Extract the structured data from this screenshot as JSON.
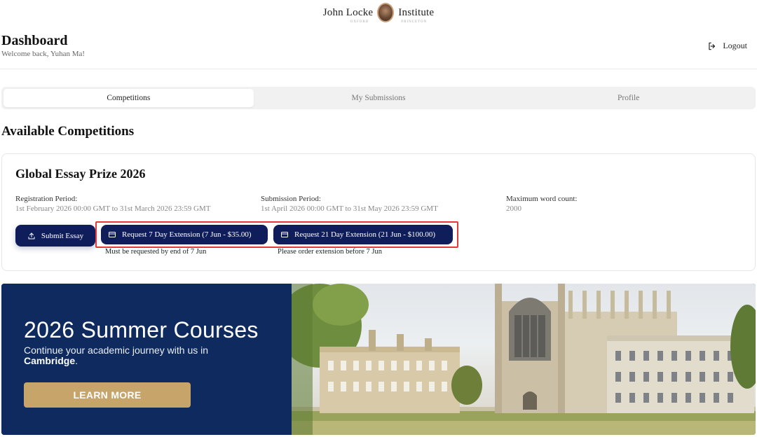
{
  "logo": {
    "left_word": "John Locke",
    "left_sub": "OXFORD",
    "right_word": "Institute",
    "right_sub": "PRINCETON"
  },
  "header": {
    "title": "Dashboard",
    "welcome": "Welcome back, Yuhan Ma!",
    "logout_label": "Logout"
  },
  "tabs": [
    {
      "label": "Competitions",
      "active": true
    },
    {
      "label": "My Submissions",
      "active": false
    },
    {
      "label": "Profile",
      "active": false
    }
  ],
  "section_title": "Available Competitions",
  "competition": {
    "title": "Global Essay Prize 2026",
    "registration": {
      "label": "Registration Period:",
      "value": "1st February 2026 00:00 GMT to 31st March 2026 23:59 GMT"
    },
    "submission": {
      "label": "Submission Period:",
      "value": "1st April 2026 00:00 GMT to 31st May 2026 23:59 GMT"
    },
    "word_count": {
      "label": "Maximum word count:",
      "value": "2000"
    },
    "buttons": {
      "submit": "Submit Essay",
      "ext7": "Request 7 Day Extension (7 Jun - $35.00)",
      "ext21": "Request 21 Day Extension (21 Jun - $100.00)"
    },
    "notes": {
      "ext7": "Must be requested by end of 7 Jun",
      "ext21": "Please order extension before 7 Jun"
    }
  },
  "banner": {
    "heading": "2026 Summer Courses",
    "text_prefix": "Continue your academic journey with us in",
    "text_bold": "Cambridge",
    "text_suffix": ".",
    "button": "LEARN MORE"
  },
  "colors": {
    "primary": "#0f1e5a",
    "banner_bg": "#0e2a5e",
    "gold": "#c6a46a",
    "highlight": "#e53935"
  }
}
